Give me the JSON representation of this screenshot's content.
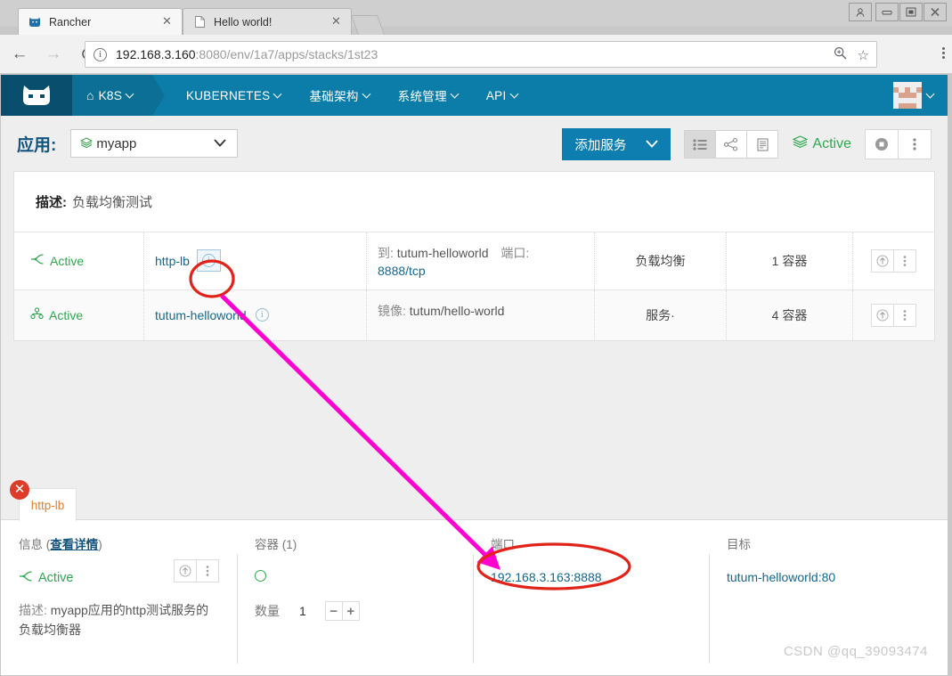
{
  "os_window": {
    "buttons": [
      {
        "name": "user-account",
        "glyph": "☹"
      },
      {
        "name": "minimize",
        "glyph": "—"
      },
      {
        "name": "maximize",
        "glyph": "□"
      },
      {
        "name": "close",
        "glyph": "✕"
      }
    ]
  },
  "browser": {
    "tabs": [
      {
        "title": "Rancher",
        "favicon": "rancher-cow-icon",
        "active": true,
        "close": "✕"
      },
      {
        "title": "Hello world!",
        "favicon": "document-icon",
        "active": false,
        "close": "✕"
      }
    ],
    "new_tab_label": "+",
    "nav": {
      "back": "←",
      "forward": "→",
      "reload": "↻"
    },
    "omnibox": {
      "info_glyph": "i",
      "host": "192.168.3.160",
      "path": ":8080/env/1a7/apps/stacks/1st23",
      "zoom_icon": "⊕",
      "bookmark_icon": "☆"
    }
  },
  "rancher_nav": {
    "logo": "rancher-cow-logo",
    "environment": "K8S",
    "home_glyph": "⌂",
    "items": [
      {
        "label": "KUBERNETES"
      },
      {
        "label": "基础架构"
      },
      {
        "label": "系统管理"
      },
      {
        "label": "API"
      }
    ]
  },
  "app_header": {
    "label": "应用:",
    "selected_stack": "myapp",
    "add_service_label": "添加服务",
    "view_modes": [
      {
        "name": "list-view",
        "glyph": "☰",
        "active": true
      },
      {
        "name": "graph-view",
        "glyph": "∝",
        "active": false
      },
      {
        "name": "config-view",
        "glyph": "▤",
        "active": false
      }
    ],
    "state": "Active",
    "actions": [
      {
        "name": "stop-action",
        "glyph": "●"
      },
      {
        "name": "more-actions",
        "glyph": "⋮"
      }
    ]
  },
  "stack_card": {
    "description_label": "描述:",
    "description_value": "负载均衡测试",
    "rows": [
      {
        "state": "Active",
        "state_icon": "load-balancer-icon",
        "name": "http-lb",
        "detail_label": "到:",
        "detail_value": "tutum-helloworld",
        "detail_label2": "端口:",
        "detail_link": "8888/tcp",
        "type": "负载均衡",
        "count": "1 容器",
        "focused": true
      },
      {
        "state": "Active",
        "state_icon": "service-icon",
        "name": "tutum-helloworld",
        "detail_label": "镜像:",
        "detail_value": "tutum/hello-world",
        "detail_label2": "",
        "detail_link": "",
        "type": "服务·",
        "count": "4 容器",
        "focused": false
      }
    ],
    "row_actions": [
      {
        "name": "upgrade-action",
        "glyph": "↑"
      },
      {
        "name": "more-actions",
        "glyph": "⋮"
      }
    ]
  },
  "drawer": {
    "close_glyph": "✕",
    "tab_label": "http-lb",
    "columns": {
      "info": {
        "title_prefix": "信息 (",
        "title_link": "查看详情",
        "title_suffix": ")",
        "state": "Active",
        "desc_label": "描述:",
        "desc_value": "myapp应用的http测试服务的负载均衡器",
        "actions": [
          {
            "name": "upgrade-action",
            "glyph": "↑"
          },
          {
            "name": "more-actions",
            "glyph": "⋮"
          }
        ]
      },
      "containers": {
        "title": "容器 (1)",
        "qty_label": "数量",
        "qty_value": "1",
        "minus": "−",
        "plus": "+"
      },
      "ports": {
        "title": "端口",
        "value": "192.168.3.163:8888"
      },
      "target": {
        "title": "目标",
        "value": "tutum-helloworld:80"
      }
    }
  },
  "annotations": {
    "arrow_color": "#ff00d0",
    "ellipse_color": "#e2231a",
    "watermark": "CSDN @qq_39093474"
  },
  "colors": {
    "rancher_blue": "#0c7ca8",
    "rancher_dark": "#0a4e6e",
    "accent_green": "#2fa84f",
    "link_blue": "#13688f",
    "title_blue": "#13547e",
    "drawer_tab_orange": "#e08030"
  }
}
